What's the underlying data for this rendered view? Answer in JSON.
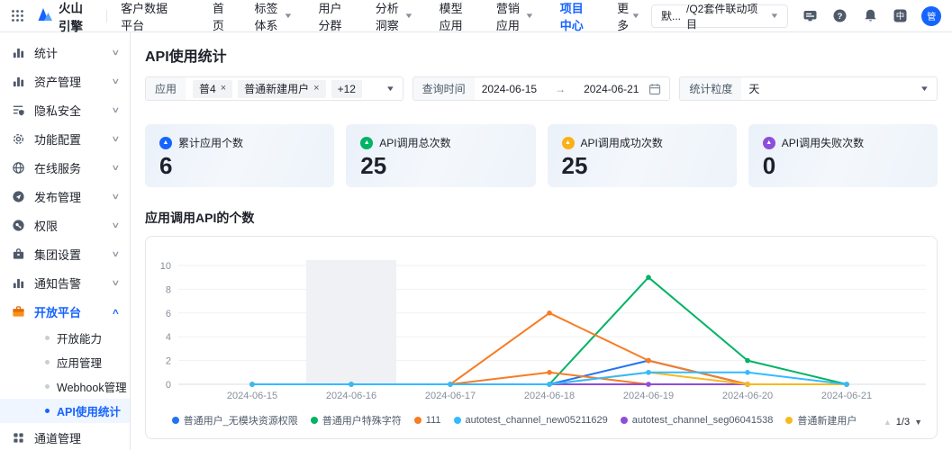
{
  "topnav": {
    "logo_text": "火山引擎",
    "product": "客户数据平台",
    "menu": [
      {
        "label": "首页",
        "caret": false,
        "active": false
      },
      {
        "label": "标签体系",
        "caret": true,
        "active": false
      },
      {
        "label": "用户分群",
        "caret": false,
        "active": false
      },
      {
        "label": "分析洞察",
        "caret": true,
        "active": false
      },
      {
        "label": "模型应用",
        "caret": false,
        "active": false
      },
      {
        "label": "营销应用",
        "caret": true,
        "active": false
      },
      {
        "label": "项目中心",
        "caret": false,
        "active": true
      },
      {
        "label": "更多",
        "caret": true,
        "active": false
      }
    ],
    "project_selector": {
      "prefix": "默...",
      "value": "/Q2套件联动项目"
    },
    "lang_badge": "中",
    "avatar_text": "管"
  },
  "sidebar": {
    "items": [
      {
        "label": "统计",
        "icon": "bar-chart",
        "chevron": "down"
      },
      {
        "label": "资产管理",
        "icon": "bar-chart",
        "chevron": "down"
      },
      {
        "label": "隐私安全",
        "icon": "privacy",
        "chevron": "down"
      },
      {
        "label": "功能配置",
        "icon": "gear",
        "chevron": "down"
      },
      {
        "label": "在线服务",
        "icon": "globe",
        "chevron": "down"
      },
      {
        "label": "发布管理",
        "icon": "send",
        "chevron": "down"
      },
      {
        "label": "权限",
        "icon": "key",
        "chevron": "down"
      },
      {
        "label": "集团设置",
        "icon": "org",
        "chevron": "down"
      },
      {
        "label": "通知告警",
        "icon": "bar-chart",
        "chevron": "down"
      },
      {
        "label": "开放平台",
        "icon": "briefcase",
        "chevron": "up",
        "active": true,
        "children": [
          {
            "label": "开放能力",
            "active": false
          },
          {
            "label": "应用管理",
            "active": false
          },
          {
            "label": "Webhook管理",
            "active": false
          },
          {
            "label": "API使用统计",
            "active": true
          }
        ]
      },
      {
        "label": "通道管理",
        "icon": "apps",
        "chevron": null
      }
    ]
  },
  "page": {
    "title": "API使用统计",
    "filters": {
      "app": {
        "label": "应用",
        "tags": [
          {
            "text": "普4",
            "closable": true
          },
          {
            "text": "普通新建用户",
            "closable": true
          },
          {
            "text": "+12",
            "closable": false
          }
        ]
      },
      "time": {
        "label": "查询时间",
        "start": "2024-06-15",
        "arrow": "→",
        "end": "2024-06-21"
      },
      "granularity": {
        "label": "统计粒度",
        "value": "天"
      }
    },
    "stats": [
      {
        "label": "累计应用个数",
        "value": "6",
        "color": "#1664ff"
      },
      {
        "label": "API调用总次数",
        "value": "25",
        "color": "#00b365"
      },
      {
        "label": "API调用成功次数",
        "value": "25",
        "color": "#fbb017"
      },
      {
        "label": "API调用失败次数",
        "value": "0",
        "color": "#8d4eda"
      }
    ],
    "section_title": "应用调用API的个数",
    "legend_pagination": {
      "up": "▲",
      "current": "1/3",
      "down": "▼"
    }
  },
  "chart_data": {
    "type": "line",
    "title": "应用调用API的个数",
    "x": [
      "2024-06-15",
      "2024-06-16",
      "2024-06-17",
      "2024-06-18",
      "2024-06-19",
      "2024-06-20",
      "2024-06-21"
    ],
    "yticks": [
      0,
      2,
      4,
      6,
      8,
      10
    ],
    "ylim": [
      0,
      10
    ],
    "grid": true,
    "legend_position": "bottom",
    "highlight_band_x": "2024-06-16",
    "series": [
      {
        "name": "普通用户_无模块资源权限",
        "color": "#2173f2",
        "values": [
          0,
          0,
          0,
          0,
          2,
          0,
          0
        ],
        "in_legend": true
      },
      {
        "name": "普通用户特殊字符",
        "color": "#00b365",
        "values": [
          0,
          0,
          0,
          0,
          9,
          2,
          0
        ],
        "in_legend": true
      },
      {
        "name": "111",
        "color": "#f77c23",
        "values": [
          0,
          0,
          0,
          6,
          2,
          0,
          0
        ],
        "in_legend": true
      },
      {
        "name": "autotest_channel_new05211629",
        "color": "#33bbff",
        "values": [
          0,
          0,
          0,
          0,
          1,
          1,
          0
        ],
        "in_legend": true
      },
      {
        "name": "autotest_channel_seg06041538",
        "color": "#8d4eda",
        "values": [
          0,
          0,
          0,
          0,
          0,
          0,
          0
        ],
        "in_legend": true
      },
      {
        "name": "普通新建用户",
        "color": "#f7ba1e",
        "values": [
          0,
          0,
          0,
          0,
          1,
          0,
          0
        ],
        "in_legend": true
      },
      {
        "name": "",
        "color": "#f77c23",
        "values": [
          0,
          0,
          0,
          1,
          0,
          0,
          0
        ],
        "in_legend": false
      }
    ]
  }
}
